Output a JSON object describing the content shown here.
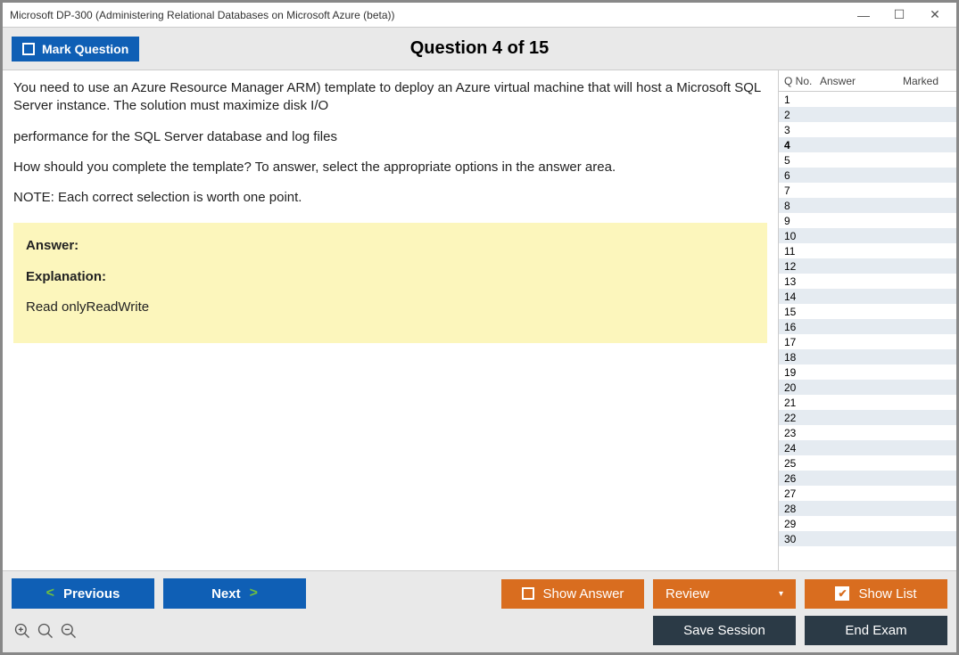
{
  "window": {
    "title": "Microsoft DP-300 (Administering Relational Databases on Microsoft Azure (beta))"
  },
  "toolbar": {
    "mark_label": "Mark Question",
    "question_title": "Question 4 of 15"
  },
  "question": {
    "p1": "You need to use an Azure Resource Manager ARM) template to deploy an Azure virtual machine that will host a Microsoft SQL Server instance. The solution must maximize disk I/O",
    "p2": "performance for the SQL Server database and log files",
    "p3": "How should you complete the template? To answer, select the appropriate options in the answer area.",
    "p4": "NOTE: Each correct selection is worth one point."
  },
  "answer": {
    "answer_label": "Answer:",
    "explanation_label": "Explanation:",
    "explanation_text": "Read onlyReadWrite"
  },
  "sidebar": {
    "col_qno": "Q No.",
    "col_answer": "Answer",
    "col_marked": "Marked",
    "rows": [
      1,
      2,
      3,
      4,
      5,
      6,
      7,
      8,
      9,
      10,
      11,
      12,
      13,
      14,
      15,
      16,
      17,
      18,
      19,
      20,
      21,
      22,
      23,
      24,
      25,
      26,
      27,
      28,
      29,
      30
    ],
    "active": 4
  },
  "footer": {
    "previous": "Previous",
    "next": "Next",
    "show_answer": "Show Answer",
    "review": "Review",
    "show_list": "Show List",
    "save_session": "Save Session",
    "end_exam": "End Exam"
  }
}
